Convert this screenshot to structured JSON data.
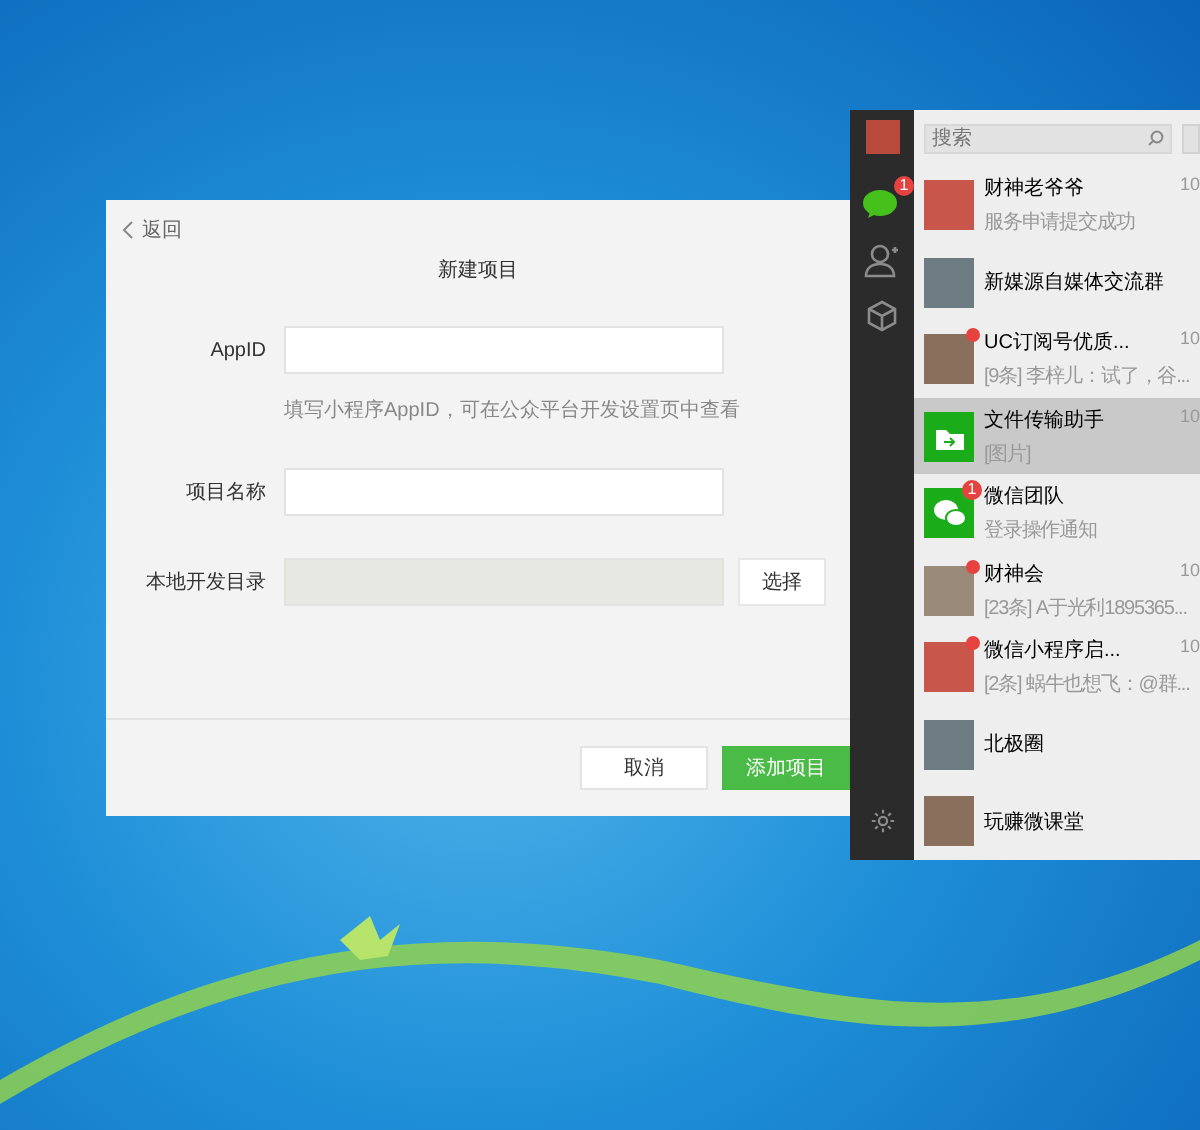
{
  "dialog": {
    "back": "返回",
    "title": "新建项目",
    "fields": [
      {
        "label": "AppID",
        "kind": "input",
        "hint": "填写小程序AppID，可在公众平台开发设置页中查看"
      },
      {
        "label": "项目名称",
        "kind": "input"
      },
      {
        "label": "本地开发目录",
        "kind": "picker",
        "disabled": true,
        "button": "选择"
      }
    ],
    "buttons": [
      {
        "label": "取消",
        "primary": false
      },
      {
        "label": "添加项目",
        "primary": true
      }
    ]
  },
  "wechat": {
    "nav": [
      {
        "selected": true,
        "badge": "1"
      },
      {
        "selected": false
      },
      {
        "selected": false
      }
    ],
    "search": {
      "placeholder": "搜索"
    },
    "chats": [
      {
        "name": "财神老爷爷",
        "preview": "服务申请提交成功",
        "time": "10",
        "kind": "photo",
        "unread_dot": false,
        "selected": false
      },
      {
        "name": "新媒源自媒体交流群",
        "kind": "photo",
        "unread_dot": false,
        "selected": false
      },
      {
        "name": "UC订阅号优质...",
        "preview": "[9条] 李梓儿：试了，谷...",
        "time": "10",
        "kind": "photo",
        "unread_dot": true,
        "selected": false
      },
      {
        "name": "文件传输助手",
        "preview": "[图片]",
        "time": "10",
        "kind": "file-transfer",
        "unread_dot": false,
        "selected": true
      },
      {
        "name": "微信团队",
        "preview": "登录操作通知",
        "kind": "wechat",
        "badge": "1",
        "unread_dot": false,
        "selected": false
      },
      {
        "name": "财神会",
        "preview": "[23条] A于光利1895365...",
        "time": "10",
        "kind": "photo",
        "unread_dot": true,
        "selected": false
      },
      {
        "name": "微信小程序启...",
        "preview": "[2条] 蜗牛也想飞：@群...",
        "time": "10",
        "kind": "photo",
        "unread_dot": true,
        "selected": false
      },
      {
        "name": "北极圈",
        "kind": "photo",
        "unread_dot": false,
        "selected": false
      },
      {
        "name": "玩赚微课堂",
        "kind": "photo",
        "unread_dot": false,
        "selected": false
      }
    ]
  }
}
